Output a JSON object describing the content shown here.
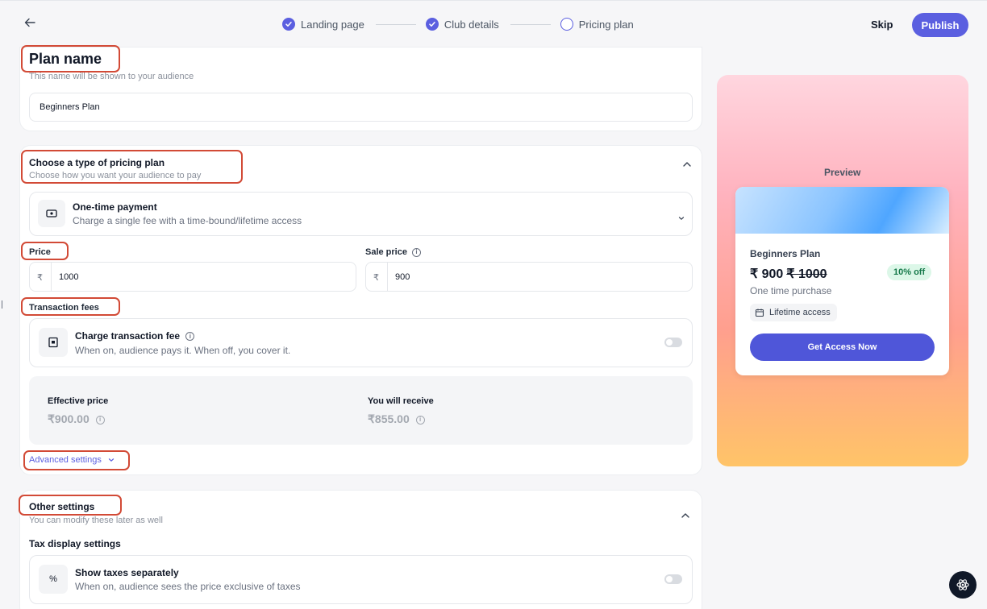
{
  "header": {
    "steps": [
      {
        "label": "Landing page",
        "state": "done"
      },
      {
        "label": "Club details",
        "state": "done"
      },
      {
        "label": "Pricing plan",
        "state": "current"
      }
    ],
    "skip_label": "Skip",
    "publish_label": "Publish"
  },
  "plan_name": {
    "title": "Plan name",
    "subtitle": "This name will be shown to your audience",
    "value": "Beginners Plan"
  },
  "pricing_type": {
    "title": "Choose a type of pricing plan",
    "subtitle": "Choose how you want your audience to pay",
    "option_title": "One-time payment",
    "option_sub": "Charge a single fee with a time-bound/lifetime access",
    "price_label": "Price",
    "sale_label": "Sale price",
    "currency": "₹",
    "price_value": "1000",
    "sale_value": "900",
    "fees_label": "Transaction fees",
    "fee_title": "Charge transaction fee",
    "fee_sub": "When on, audience pays it. When off, you cover it.",
    "effective_label": "Effective price",
    "effective_value": "₹900.00",
    "receive_label": "You will receive",
    "receive_value": "₹855.00",
    "advanced_label": "Advanced settings"
  },
  "other": {
    "title": "Other settings",
    "subtitle": "You can modify these later as well",
    "tax_heading": "Tax display settings",
    "tax_title": "Show taxes separately",
    "tax_sub": "When on, audience sees the price exclusive of taxes"
  },
  "preview": {
    "label": "Preview",
    "plan": "Beginners Plan",
    "price": "₹ 900",
    "old_price": "₹ 1000",
    "discount": "10% off",
    "type": "One time purchase",
    "access": "Lifetime access",
    "cta": "Get Access Now"
  },
  "colors": {
    "accent": "#5b5fe0",
    "annotation": "#d24a36"
  }
}
